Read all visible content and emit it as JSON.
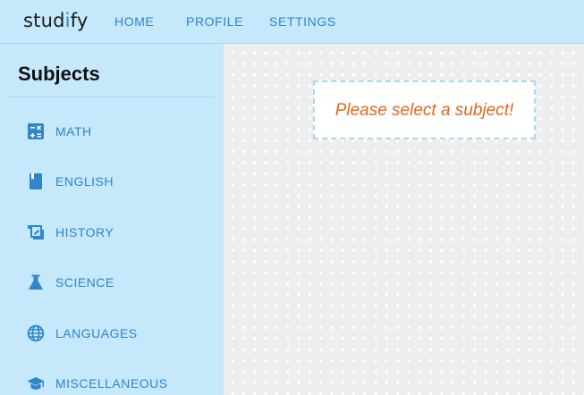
{
  "app": {
    "logo": {
      "prefix": "stud",
      "accent": "i",
      "suffix": "fy"
    },
    "accent_color": "#2a84d6",
    "nav": [
      {
        "label": "HOME"
      },
      {
        "label": "PROFILE"
      },
      {
        "label": "SETTINGS"
      }
    ]
  },
  "sidebar": {
    "title": "Subjects",
    "items": [
      {
        "label": "MATH",
        "icon": "calculator-icon"
      },
      {
        "label": "ENGLISH",
        "icon": "book-icon"
      },
      {
        "label": "HISTORY",
        "icon": "history-scroll-icon"
      },
      {
        "label": "SCIENCE",
        "icon": "flask-icon"
      },
      {
        "label": "LANGUAGES",
        "icon": "globe-icon"
      },
      {
        "label": "MISCELLANEOUS",
        "icon": "graduation-cap-icon"
      }
    ]
  },
  "main": {
    "message": "Please select a subject!",
    "message_color": "#e8641b"
  }
}
